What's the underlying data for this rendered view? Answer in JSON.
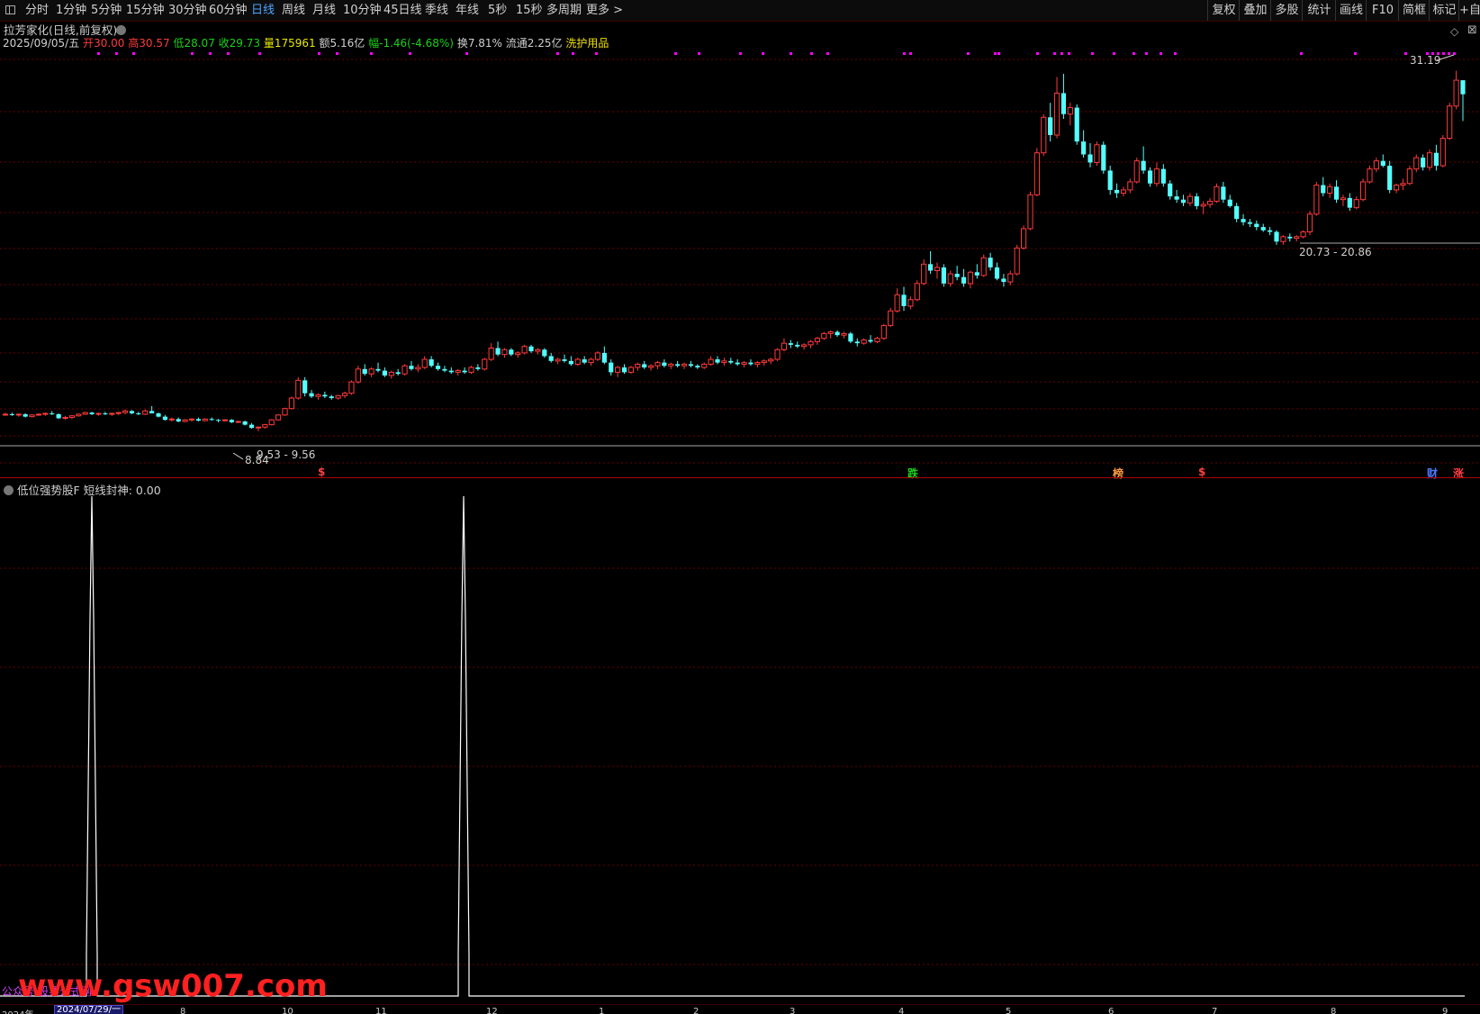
{
  "toolbar": {
    "periods": [
      {
        "label": "分时",
        "active": false
      },
      {
        "label": "1分钟",
        "active": false
      },
      {
        "label": "5分钟",
        "active": false
      },
      {
        "label": "15分钟",
        "active": false
      },
      {
        "label": "30分钟",
        "active": false
      },
      {
        "label": "60分钟",
        "active": false
      },
      {
        "label": "日线",
        "active": true
      },
      {
        "label": "周线",
        "active": false
      },
      {
        "label": "月线",
        "active": false
      },
      {
        "label": "10分钟",
        "active": false
      },
      {
        "label": "45日线",
        "active": false
      },
      {
        "label": "季线",
        "active": false
      },
      {
        "label": "年线",
        "active": false
      },
      {
        "label": "5秒",
        "active": false
      },
      {
        "label": "15秒",
        "active": false
      },
      {
        "label": "多周期",
        "active": false
      },
      {
        "label": "更多 >",
        "active": false
      }
    ],
    "tools": [
      "复权",
      "叠加",
      "多股",
      "统计",
      "画线",
      "F10",
      "简框",
      "标记",
      "+自"
    ]
  },
  "stock": {
    "title": "拉芳家化(日线,前复权)",
    "date": "2025/09/05/五",
    "open_label": "开",
    "open": "30.00",
    "high_label": "高",
    "high": "30.57",
    "low_label": "低",
    "low": "28.07",
    "close_label": "收",
    "close": "29.73",
    "vol_label": "量",
    "vol": "175961",
    "amount_label": "额",
    "amount": "5.16亿",
    "change_label": "幅",
    "change": "-1.46(-4.68%)",
    "turnover_label": "换",
    "turnover": "7.81%",
    "float_label": "流通",
    "float": "2.25亿",
    "concept": "洗护用品"
  },
  "annotations": {
    "high_price": "31.19",
    "low_price": "8.84",
    "range_low": "9.53 - 9.56",
    "range_mid": "20.73 - 20.86"
  },
  "events": [
    {
      "text": "$",
      "color": "#ff4040"
    },
    {
      "text": "跌",
      "color": "#19d219"
    },
    {
      "text": "榜",
      "color": "#ff9a40"
    },
    {
      "text": "$",
      "color": "#ff4040"
    },
    {
      "text": "财",
      "color": "#4a7aff"
    },
    {
      "text": "涨",
      "color": "#ff4040"
    }
  ],
  "indicator": {
    "name": "低位强势股F",
    "line_label": "短线封神: 0.00"
  },
  "watermark": {
    "text": "www.gsw007.com",
    "small": "公众号:股票公式网"
  },
  "axis": {
    "cursor_date": "2024/07/29/一",
    "ticks": [
      "2024年",
      "8",
      "10",
      "11",
      "12",
      "1",
      "2",
      "3",
      "4",
      "5",
      "6",
      "7",
      "8",
      "9"
    ]
  },
  "colors": {
    "up": "#ff3b3b",
    "down": "#54ffff",
    "grid": "#6a0000",
    "indicator_line": "#ffffff",
    "signal_dot": "#ff00ff"
  },
  "chart_data": {
    "type": "candlestick",
    "title": "",
    "ylim": [
      8.0,
      32.0
    ],
    "series_ohlc_note": "",
    "ohlc": [
      [
        9.9,
        10.0,
        9.8,
        9.9
      ],
      [
        9.9,
        10.0,
        9.8,
        9.85
      ],
      [
        9.85,
        9.95,
        9.75,
        9.9
      ],
      [
        9.9,
        9.95,
        9.7,
        9.75
      ],
      [
        9.75,
        9.9,
        9.7,
        9.85
      ],
      [
        9.85,
        9.95,
        9.8,
        9.9
      ],
      [
        9.9,
        10.0,
        9.8,
        9.95
      ],
      [
        9.95,
        10.1,
        9.85,
        9.9
      ],
      [
        9.9,
        9.95,
        9.6,
        9.65
      ],
      [
        9.65,
        9.8,
        9.55,
        9.7
      ],
      [
        9.7,
        9.85,
        9.6,
        9.8
      ],
      [
        9.8,
        9.95,
        9.75,
        9.9
      ],
      [
        9.9,
        10.05,
        9.85,
        10.0
      ],
      [
        10.0,
        10.05,
        9.85,
        9.9
      ],
      [
        9.9,
        10.0,
        9.8,
        9.95
      ],
      [
        9.95,
        10.05,
        9.85,
        9.9
      ],
      [
        9.9,
        10.0,
        9.8,
        9.95
      ],
      [
        9.95,
        10.05,
        9.85,
        10.0
      ],
      [
        10.0,
        10.2,
        9.9,
        10.1
      ],
      [
        10.1,
        10.15,
        9.9,
        9.95
      ],
      [
        9.95,
        10.05,
        9.85,
        9.9
      ],
      [
        9.9,
        10.2,
        9.85,
        10.1
      ],
      [
        10.1,
        10.4,
        10.0,
        9.95
      ],
      [
        9.95,
        10.0,
        9.7,
        9.75
      ],
      [
        9.75,
        9.85,
        9.5,
        9.55
      ],
      [
        9.55,
        9.7,
        9.45,
        9.6
      ],
      [
        9.6,
        9.7,
        9.4,
        9.45
      ],
      [
        9.45,
        9.6,
        9.4,
        9.55
      ],
      [
        9.55,
        9.65,
        9.45,
        9.6
      ],
      [
        9.6,
        9.7,
        9.45,
        9.5
      ],
      [
        9.5,
        9.65,
        9.45,
        9.6
      ],
      [
        9.6,
        9.7,
        9.5,
        9.55
      ],
      [
        9.55,
        9.6,
        9.4,
        9.5
      ],
      [
        9.5,
        9.6,
        9.45,
        9.55
      ],
      [
        9.55,
        9.6,
        9.35,
        9.4
      ],
      [
        9.4,
        9.5,
        9.35,
        9.45
      ],
      [
        9.45,
        9.5,
        9.2,
        9.25
      ],
      [
        9.25,
        9.35,
        9.0,
        9.05
      ],
      [
        9.05,
        9.15,
        8.84,
        9.1
      ],
      [
        9.1,
        9.3,
        9.0,
        9.25
      ],
      [
        9.25,
        9.6,
        9.2,
        9.55
      ],
      [
        9.55,
        9.9,
        9.5,
        9.85
      ],
      [
        9.85,
        10.3,
        9.8,
        10.25
      ],
      [
        10.25,
        11.0,
        10.2,
        10.9
      ],
      [
        10.9,
        12.2,
        10.8,
        12.0
      ],
      [
        12.0,
        12.2,
        11.0,
        11.2
      ],
      [
        11.2,
        11.4,
        10.9,
        11.0
      ],
      [
        11.0,
        11.2,
        10.8,
        11.1
      ],
      [
        11.1,
        11.3,
        10.9,
        11.0
      ],
      [
        11.0,
        11.1,
        10.8,
        10.9
      ],
      [
        10.9,
        11.1,
        10.8,
        11.05
      ],
      [
        11.05,
        11.3,
        10.9,
        11.2
      ],
      [
        11.2,
        12.0,
        11.1,
        11.9
      ],
      [
        11.9,
        12.9,
        11.8,
        12.7
      ],
      [
        12.7,
        13.0,
        12.3,
        12.4
      ],
      [
        12.4,
        12.8,
        12.2,
        12.7
      ],
      [
        12.7,
        13.1,
        12.5,
        12.6
      ],
      [
        12.6,
        12.8,
        12.2,
        12.3
      ],
      [
        12.3,
        12.6,
        12.1,
        12.5
      ],
      [
        12.5,
        12.7,
        12.3,
        12.4
      ],
      [
        12.4,
        13.0,
        12.3,
        12.9
      ],
      [
        12.9,
        13.2,
        12.6,
        12.7
      ],
      [
        12.7,
        13.0,
        12.5,
        12.8
      ],
      [
        12.8,
        13.5,
        12.7,
        13.3
      ],
      [
        13.3,
        13.5,
        12.8,
        12.9
      ],
      [
        12.9,
        13.1,
        12.6,
        12.7
      ],
      [
        12.7,
        12.9,
        12.5,
        12.6
      ],
      [
        12.6,
        12.8,
        12.4,
        12.5
      ],
      [
        12.5,
        12.7,
        12.3,
        12.6
      ],
      [
        12.6,
        12.8,
        12.4,
        12.5
      ],
      [
        12.5,
        12.9,
        12.4,
        12.8
      ],
      [
        12.8,
        13.0,
        12.6,
        12.7
      ],
      [
        12.7,
        13.4,
        12.6,
        13.3
      ],
      [
        13.3,
        14.3,
        13.2,
        14.0
      ],
      [
        14.0,
        14.4,
        13.5,
        13.6
      ],
      [
        13.6,
        14.0,
        13.4,
        13.9
      ],
      [
        13.9,
        14.0,
        13.5,
        13.6
      ],
      [
        13.6,
        13.8,
        13.4,
        13.7
      ],
      [
        13.7,
        14.2,
        13.6,
        14.1
      ],
      [
        14.1,
        14.2,
        13.7,
        13.8
      ],
      [
        13.8,
        14.0,
        13.6,
        13.9
      ],
      [
        13.9,
        14.0,
        13.4,
        13.5
      ],
      [
        13.5,
        13.7,
        13.1,
        13.2
      ],
      [
        13.2,
        13.4,
        13.0,
        13.3
      ],
      [
        13.3,
        13.6,
        13.1,
        13.2
      ],
      [
        13.2,
        13.5,
        12.9,
        13.0
      ],
      [
        13.0,
        13.4,
        12.9,
        13.3
      ],
      [
        13.3,
        13.5,
        13.0,
        13.1
      ],
      [
        13.1,
        13.4,
        12.9,
        13.3
      ],
      [
        13.3,
        13.8,
        13.2,
        13.7
      ],
      [
        13.7,
        14.1,
        13.0,
        13.1
      ],
      [
        13.1,
        13.3,
        12.3,
        12.5
      ],
      [
        12.5,
        12.9,
        12.2,
        12.8
      ],
      [
        12.8,
        13.0,
        12.4,
        12.5
      ],
      [
        12.5,
        12.9,
        12.4,
        12.8
      ],
      [
        12.8,
        13.1,
        12.6,
        13.0
      ],
      [
        13.0,
        13.2,
        12.7,
        12.8
      ],
      [
        12.8,
        13.0,
        12.6,
        12.9
      ],
      [
        12.9,
        13.2,
        12.7,
        13.1
      ],
      [
        13.1,
        13.3,
        12.8,
        12.9
      ],
      [
        12.9,
        13.1,
        12.7,
        13.0
      ],
      [
        13.0,
        13.2,
        12.8,
        12.9
      ],
      [
        12.9,
        13.1,
        12.7,
        13.0
      ],
      [
        13.0,
        13.2,
        12.8,
        12.9
      ],
      [
        12.9,
        13.0,
        12.7,
        12.8
      ],
      [
        12.8,
        13.1,
        12.7,
        13.0
      ],
      [
        13.0,
        13.5,
        12.9,
        13.3
      ],
      [
        13.3,
        13.5,
        13.0,
        13.1
      ],
      [
        13.1,
        13.4,
        12.9,
        13.2
      ],
      [
        13.2,
        13.4,
        13.0,
        13.1
      ],
      [
        13.1,
        13.3,
        12.9,
        13.0
      ],
      [
        13.0,
        13.2,
        12.8,
        13.1
      ],
      [
        13.1,
        13.3,
        12.9,
        13.0
      ],
      [
        13.0,
        13.2,
        12.8,
        13.1
      ],
      [
        13.1,
        13.3,
        12.9,
        13.2
      ],
      [
        13.2,
        13.4,
        13.0,
        13.3
      ],
      [
        13.3,
        14.0,
        13.2,
        13.9
      ],
      [
        13.9,
        14.6,
        13.8,
        14.3
      ],
      [
        14.3,
        14.5,
        14.0,
        14.2
      ],
      [
        14.2,
        14.4,
        14.0,
        14.1
      ],
      [
        14.1,
        14.3,
        13.9,
        14.2
      ],
      [
        14.2,
        14.5,
        14.0,
        14.4
      ],
      [
        14.4,
        14.7,
        14.2,
        14.6
      ],
      [
        14.6,
        15.0,
        14.5,
        14.9
      ],
      [
        14.9,
        15.1,
        14.6,
        15.0
      ],
      [
        15.0,
        15.1,
        14.7,
        14.8
      ],
      [
        14.8,
        15.0,
        14.6,
        14.9
      ],
      [
        14.9,
        15.0,
        14.3,
        14.4
      ],
      [
        14.4,
        14.6,
        14.1,
        14.3
      ],
      [
        14.3,
        14.6,
        14.2,
        14.5
      ],
      [
        14.5,
        14.8,
        14.3,
        14.4
      ],
      [
        14.4,
        14.7,
        14.3,
        14.6
      ],
      [
        14.6,
        15.5,
        14.5,
        15.4
      ],
      [
        15.4,
        16.5,
        15.3,
        16.3
      ],
      [
        16.3,
        17.7,
        16.2,
        17.3
      ],
      [
        17.3,
        17.8,
        16.3,
        16.6
      ],
      [
        16.6,
        17.2,
        16.4,
        17.0
      ],
      [
        17.0,
        18.2,
        16.9,
        18.0
      ],
      [
        18.0,
        19.5,
        17.9,
        19.2
      ],
      [
        19.2,
        20.0,
        18.6,
        18.8
      ],
      [
        18.8,
        19.3,
        18.3,
        19.0
      ],
      [
        19.0,
        19.2,
        17.8,
        18.0
      ],
      [
        18.0,
        18.8,
        17.8,
        18.6
      ],
      [
        18.6,
        19.1,
        18.2,
        18.4
      ],
      [
        18.4,
        18.9,
        17.8,
        18.0
      ],
      [
        18.0,
        18.8,
        17.7,
        18.7
      ],
      [
        18.7,
        19.2,
        18.3,
        18.5
      ],
      [
        18.5,
        19.8,
        18.4,
        19.6
      ],
      [
        19.6,
        19.9,
        18.8,
        19.0
      ],
      [
        19.0,
        19.3,
        18.2,
        18.3
      ],
      [
        18.3,
        18.6,
        17.8,
        18.1
      ],
      [
        18.1,
        18.8,
        17.9,
        18.6
      ],
      [
        18.6,
        20.4,
        18.5,
        20.2
      ],
      [
        20.2,
        21.6,
        20.1,
        21.4
      ],
      [
        21.4,
        23.7,
        21.3,
        23.5
      ],
      [
        23.5,
        26.4,
        23.4,
        26.1
      ],
      [
        26.1,
        28.5,
        25.9,
        28.3
      ],
      [
        28.3,
        29.2,
        26.8,
        27.2
      ],
      [
        27.2,
        30.8,
        27.0,
        29.8
      ],
      [
        29.8,
        31.0,
        28.2,
        28.5
      ],
      [
        28.5,
        29.2,
        27.8,
        28.9
      ],
      [
        28.9,
        29.1,
        26.6,
        26.8
      ],
      [
        26.8,
        27.5,
        25.8,
        26.0
      ],
      [
        26.0,
        26.7,
        25.2,
        25.5
      ],
      [
        25.5,
        26.8,
        25.3,
        26.6
      ],
      [
        26.6,
        26.8,
        24.8,
        25.0
      ],
      [
        25.0,
        25.3,
        23.5,
        23.8
      ],
      [
        23.8,
        24.2,
        23.3,
        23.6
      ],
      [
        23.6,
        24.0,
        23.4,
        23.8
      ],
      [
        23.8,
        24.5,
        23.6,
        24.3
      ],
      [
        24.3,
        25.8,
        24.2,
        25.6
      ],
      [
        25.6,
        26.5,
        24.8,
        25.0
      ],
      [
        25.0,
        25.2,
        24.0,
        24.2
      ],
      [
        24.2,
        25.5,
        24.0,
        25.1
      ],
      [
        25.1,
        25.4,
        24.0,
        24.2
      ],
      [
        24.2,
        24.4,
        23.2,
        23.4
      ],
      [
        23.4,
        23.8,
        23.0,
        23.2
      ],
      [
        23.2,
        23.5,
        22.8,
        23.0
      ],
      [
        23.0,
        23.6,
        22.8,
        23.4
      ],
      [
        23.4,
        23.6,
        22.6,
        22.8
      ],
      [
        22.8,
        23.1,
        22.3,
        22.9
      ],
      [
        22.9,
        23.3,
        22.7,
        23.1
      ],
      [
        23.1,
        24.2,
        23.0,
        24.0
      ],
      [
        24.0,
        24.3,
        23.0,
        23.2
      ],
      [
        23.2,
        23.5,
        22.7,
        22.8
      ],
      [
        22.8,
        23.0,
        21.8,
        22.0
      ],
      [
        22.0,
        22.3,
        21.6,
        21.8
      ],
      [
        21.8,
        22.0,
        21.5,
        21.7
      ],
      [
        21.7,
        21.9,
        21.3,
        21.5
      ],
      [
        21.5,
        21.7,
        21.2,
        21.3
      ],
      [
        21.3,
        21.5,
        21.0,
        21.2
      ],
      [
        21.2,
        21.3,
        20.4,
        20.6
      ],
      [
        20.6,
        21.0,
        20.4,
        20.9
      ],
      [
        20.9,
        21.1,
        20.6,
        20.8
      ],
      [
        20.8,
        21.0,
        20.6,
        20.9
      ],
      [
        20.9,
        21.3,
        20.8,
        21.2
      ],
      [
        21.2,
        22.5,
        21.0,
        22.3
      ],
      [
        22.3,
        24.3,
        22.2,
        24.1
      ],
      [
        24.1,
        24.6,
        23.4,
        23.6
      ],
      [
        23.6,
        24.2,
        23.3,
        24.0
      ],
      [
        24.0,
        24.4,
        23.0,
        23.2
      ],
      [
        23.2,
        23.5,
        22.8,
        23.3
      ],
      [
        23.3,
        23.6,
        22.5,
        22.7
      ],
      [
        22.7,
        23.4,
        22.6,
        23.2
      ],
      [
        23.2,
        24.5,
        23.1,
        24.3
      ],
      [
        24.3,
        25.3,
        24.2,
        25.1
      ],
      [
        25.1,
        25.8,
        24.9,
        25.6
      ],
      [
        25.6,
        26.0,
        25.2,
        25.3
      ],
      [
        25.3,
        25.6,
        23.6,
        23.8
      ],
      [
        23.8,
        24.2,
        23.6,
        24.1
      ],
      [
        24.1,
        24.5,
        23.8,
        24.2
      ],
      [
        24.2,
        25.3,
        24.1,
        25.1
      ],
      [
        25.1,
        26.0,
        24.9,
        25.8
      ],
      [
        25.8,
        26.0,
        25.0,
        25.2
      ],
      [
        25.2,
        26.3,
        25.0,
        26.1
      ],
      [
        26.1,
        26.6,
        25.0,
        25.3
      ],
      [
        25.3,
        27.2,
        25.2,
        27.0
      ],
      [
        27.0,
        29.2,
        26.9,
        29.0
      ],
      [
        29.0,
        31.19,
        28.8,
        30.6
      ],
      [
        30.6,
        30.57,
        28.07,
        29.73
      ]
    ]
  }
}
